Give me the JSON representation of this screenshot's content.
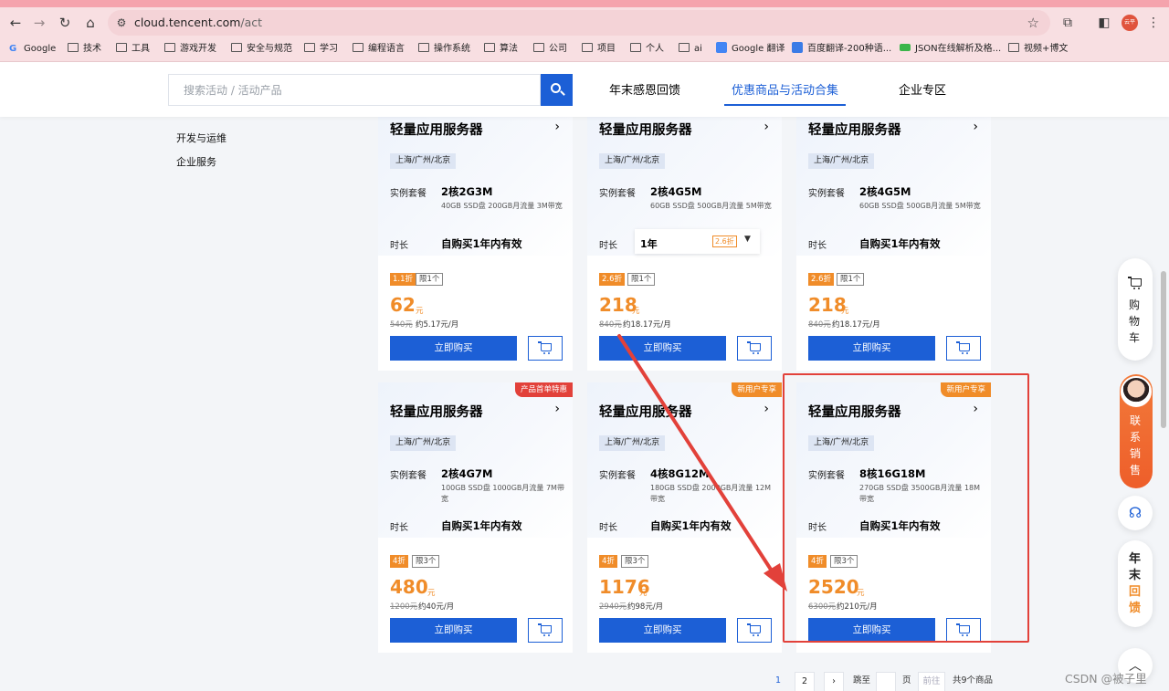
{
  "browser": {
    "url_host": "cloud.tencent.com",
    "url_path": "/act",
    "profile_label": "云平",
    "bookmarks": [
      "Google",
      "技术",
      "工具",
      "游戏开发",
      "安全与规范",
      "学习",
      "编程语言",
      "操作系统",
      "算法",
      "公司",
      "项目",
      "个人",
      "ai",
      "Google 翻译",
      "百度翻译-200种语...",
      "JSON在线解析及格...",
      "视频+博文"
    ]
  },
  "header": {
    "search_placeholder": "搜索活动 / 活动产品",
    "tabs": [
      {
        "label": "年末感恩回馈",
        "active": false
      },
      {
        "label": "优惠商品与活动合集",
        "active": true
      },
      {
        "label": "企业专区",
        "active": false
      }
    ]
  },
  "sidebar": {
    "items": [
      "开发与运维",
      "企业服务"
    ]
  },
  "labels": {
    "spec": "实例套餐",
    "duration": "时长",
    "buy": "立即购买",
    "yuan": "元"
  },
  "cards": [
    {
      "title": "轻量应用服务器",
      "region": "上海/广州/北京",
      "spec": "2核2G3M",
      "spec_detail": "40GB SSD盘 200GB月流量 3M带宽",
      "duration": "自购买1年内有效",
      "discount": "1.1折",
      "limit": "限1个",
      "price": "62",
      "original": "540元",
      "monthly": "约5.17元/月",
      "corner": ""
    },
    {
      "title": "轻量应用服务器",
      "region": "上海/广州/北京",
      "spec": "2核4G5M",
      "spec_detail": "60GB SSD盘 500GB月流量 5M带宽",
      "duration": "1年",
      "duration_badge": "2.6折",
      "discount": "2.6折",
      "limit": "限1个",
      "price": "218",
      "original": "840元",
      "monthly": "约18.17元/月",
      "corner": ""
    },
    {
      "title": "轻量应用服务器",
      "region": "上海/广州/北京",
      "spec": "2核4G5M",
      "spec_detail": "60GB SSD盘 500GB月流量 5M带宽",
      "duration": "自购买1年内有效",
      "discount": "2.6折",
      "limit": "限1个",
      "price": "218",
      "original": "840元",
      "monthly": "约18.17元/月",
      "corner": ""
    },
    {
      "title": "轻量应用服务器",
      "region": "上海/广州/北京",
      "spec": "2核4G7M",
      "spec_detail": "100GB SSD盘 1000GB月流量 7M带宽",
      "duration": "自购买1年内有效",
      "discount": "4折",
      "limit": "限3个",
      "price": "480",
      "original": "1200元",
      "monthly": "约40元/月",
      "corner": "产品首单特惠"
    },
    {
      "title": "轻量应用服务器",
      "region": "上海/广州/北京",
      "spec": "4核8G12M",
      "spec_detail": "180GB SSD盘 2000GB月流量 12M带宽",
      "duration": "自购买1年内有效",
      "discount": "4折",
      "limit": "限3个",
      "price": "1176",
      "original": "2940元",
      "monthly": "约98元/月",
      "corner": "新用户专享"
    },
    {
      "title": "轻量应用服务器",
      "region": "上海/广州/北京",
      "spec": "8核16G18M",
      "spec_detail": "270GB SSD盘 3500GB月流量 18M带宽",
      "duration": "自购买1年内有效",
      "discount": "4折",
      "limit": "限3个",
      "price": "2520",
      "original": "6300元",
      "monthly": "约210元/月",
      "corner": "新用户专享"
    }
  ],
  "float": {
    "cart_label": "购物车",
    "sales_label": "联系销售",
    "year_label_a": "年末",
    "year_label_b": "回馈"
  },
  "pagination": {
    "current": "1",
    "next_page": "2",
    "jump_label": "跳至",
    "page_unit": "页",
    "go_label": "前往",
    "total": "共9个商品"
  },
  "watermark": "CSDN @被子里",
  "colors": {
    "brand_blue": "#1c5fd6",
    "price_orange": "#f08c29",
    "annotation_red": "#e2413a"
  }
}
